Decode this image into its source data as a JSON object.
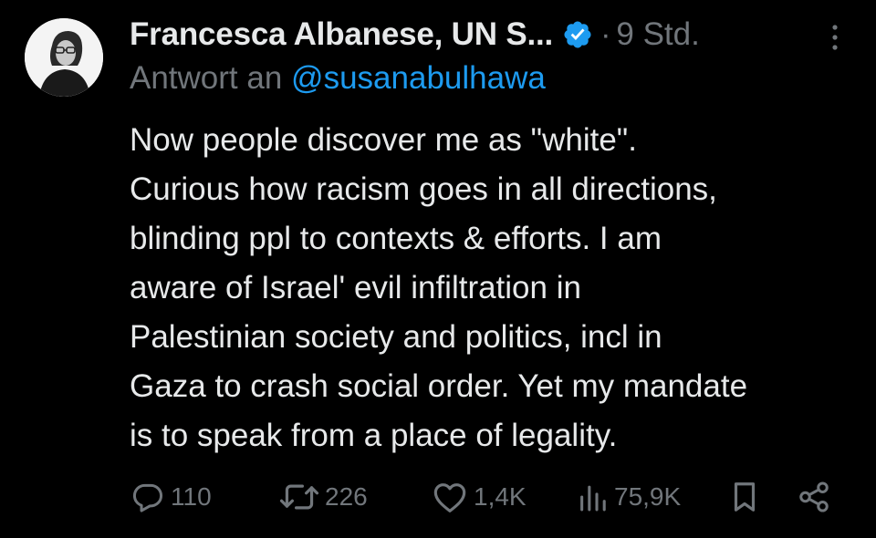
{
  "tweet": {
    "author_name": "Francesca Albanese, UN S...",
    "verified_icon": "verified-badge-icon",
    "separator": "·",
    "time": "9 Std.",
    "reply_prefix": "Antwort an",
    "reply_handle": "@susanabulhawa",
    "lines": [
      "Now people discover me as \"white\".",
      "Curious how racism goes in all directions,",
      "blinding ppl to contexts & efforts. I am",
      "aware of Israel' evil infiltration in",
      "Palestinian society and politics, incl in",
      "Gaza to crash social order. Yet my mandate",
      "is to speak from a place of legality."
    ]
  },
  "actions": {
    "replies": "110",
    "reposts": "226",
    "likes": "1,4K",
    "views": "75,9K"
  },
  "colors": {
    "background": "#000000",
    "text": "#e7e9ea",
    "muted": "#71767b",
    "accent": "#1d9bf0"
  }
}
